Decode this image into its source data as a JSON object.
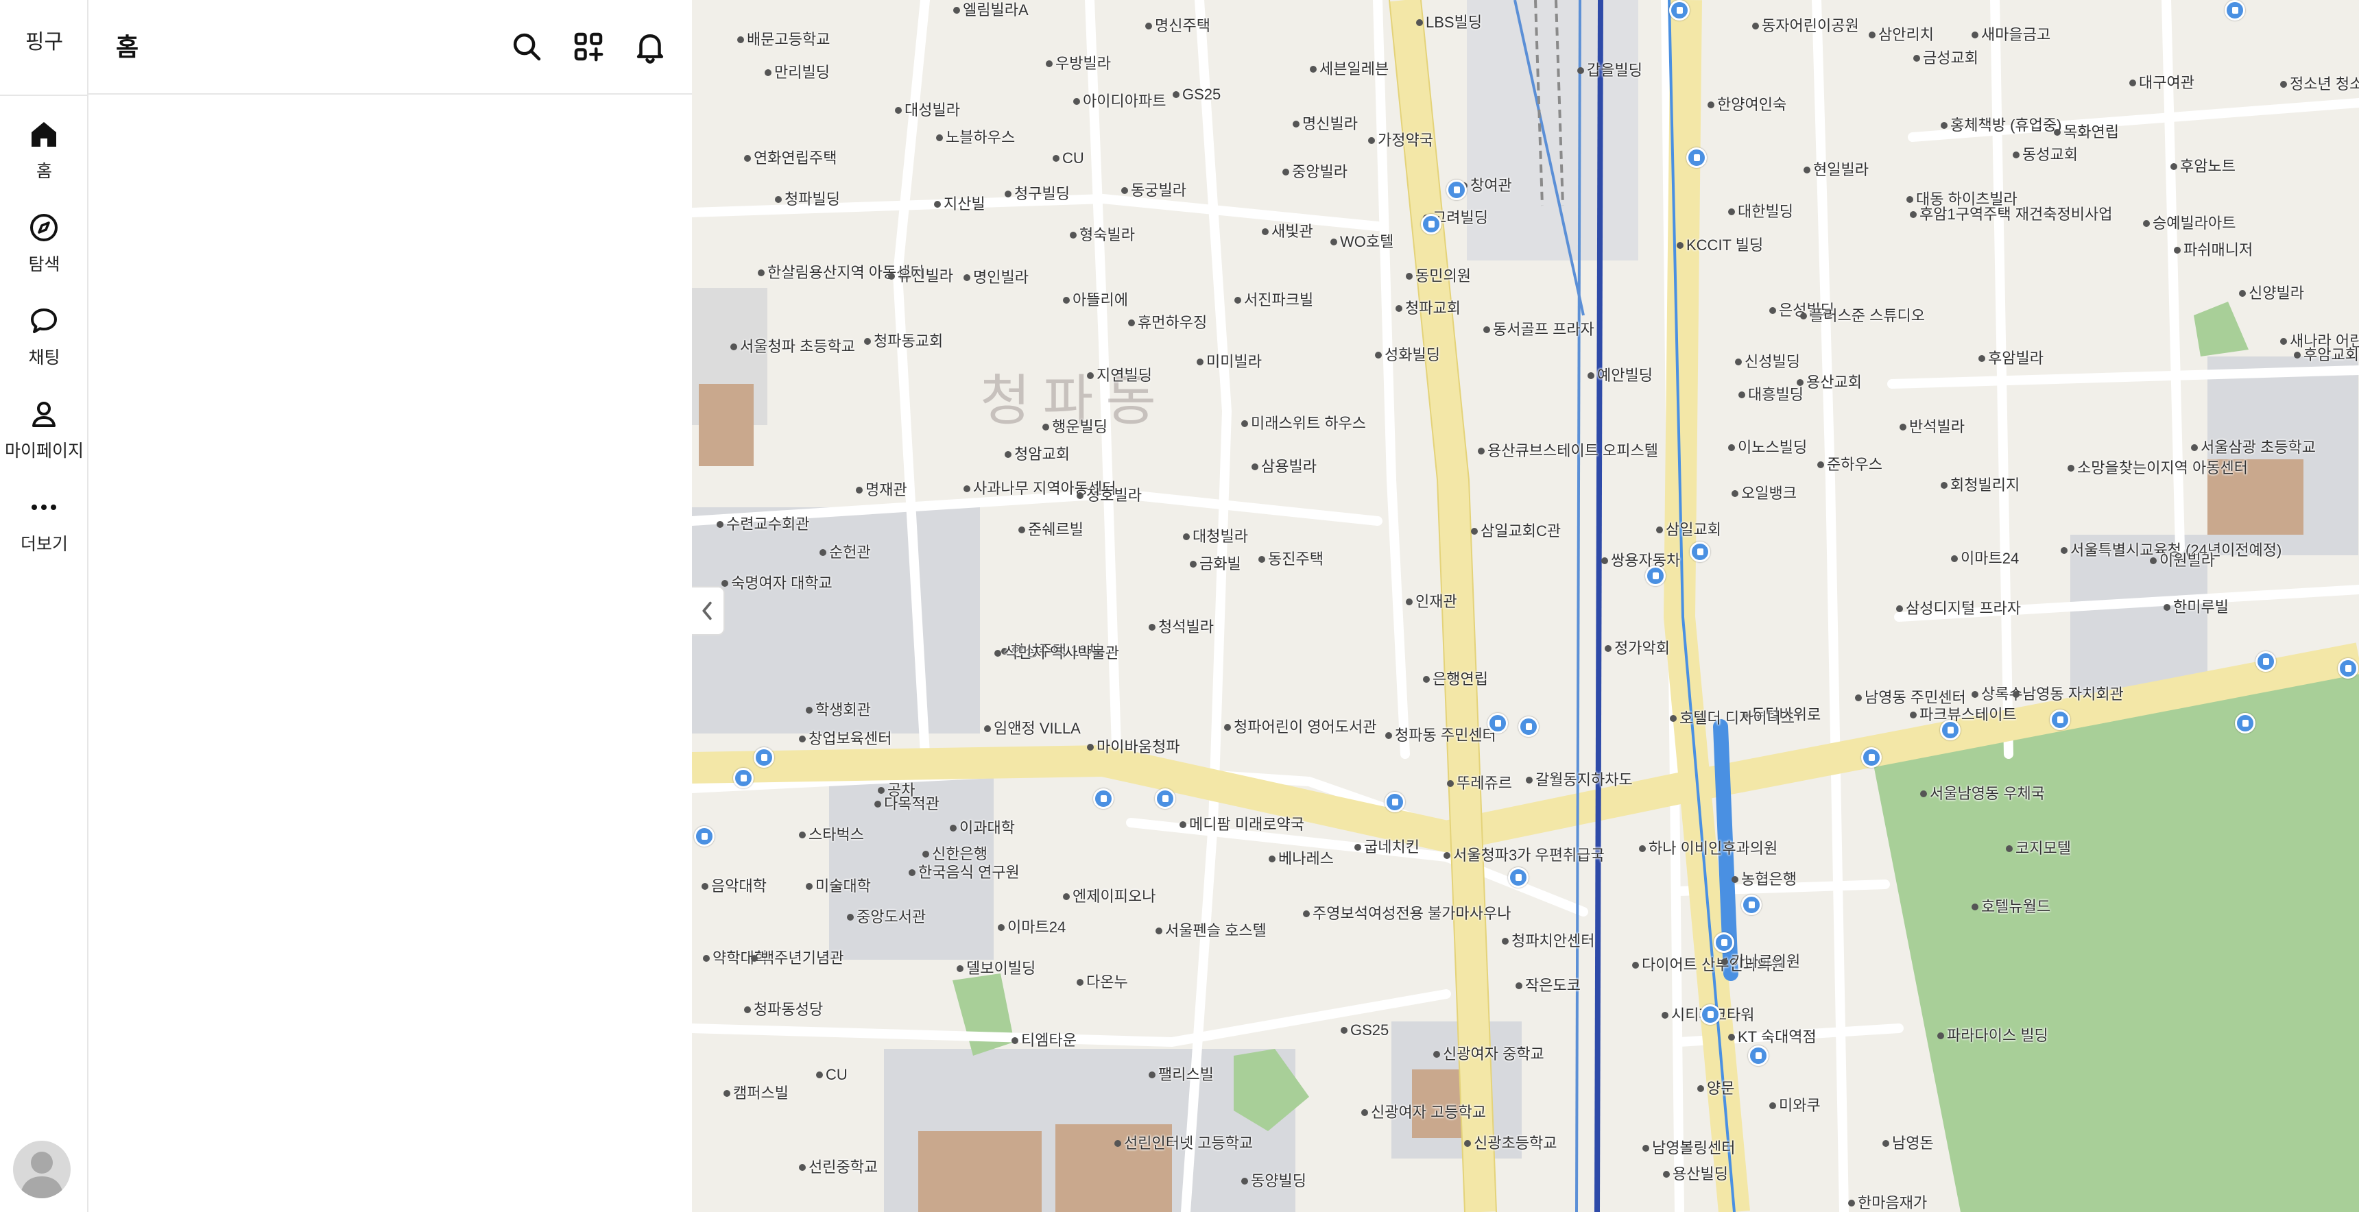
{
  "app": {
    "brand": "핑구"
  },
  "rail": {
    "items": [
      {
        "key": "home",
        "label": "홈",
        "icon": "home-icon"
      },
      {
        "key": "explore",
        "label": "탐색",
        "icon": "compass-icon"
      },
      {
        "key": "chat",
        "label": "채팅",
        "icon": "chat-bubble-icon"
      },
      {
        "key": "mypage",
        "label": "마이페이지",
        "icon": "user-icon"
      },
      {
        "key": "more",
        "label": "더보기",
        "icon": "more-dots-icon"
      }
    ],
    "avatar_icon": "avatar-icon"
  },
  "panel": {
    "title": "홈",
    "header_icons": [
      "search-icon",
      "apps-add-icon",
      "bell-icon"
    ]
  },
  "map": {
    "district_name": "청파동",
    "labels": [
      "엘림빌라A",
      "명신주택",
      "LBS빌딩",
      "동자어린이공원",
      "삼안리치",
      "새마을금고",
      "배문고등학교",
      "우방빌라",
      "세븐일레븐",
      "갑을빌딩",
      "금성교회",
      "대구여관",
      "정소년 청소년",
      "만리빌딩",
      "아이디아파트",
      "GS25",
      "명신빌라",
      "한양여인숙",
      "홍체책방 (휴업중)",
      "목화연립",
      "후암노트",
      "대성빌라",
      "노블하우스",
      "CU",
      "가정약국",
      "동성교회",
      "연화연립주택",
      "중앙빌라",
      "현일빌라",
      "청파빌딩",
      "지산빌",
      "청구빌딩",
      "동궁빌라",
      "창여관",
      "대한빌딩",
      "대동 하이츠빌라",
      "후암1구역주택 재건축정비사업",
      "승예빌라아트",
      "새빛관",
      "고려빌딩",
      "한살림용산지역 아동센터",
      "유진빌라",
      "명인빌라",
      "형숙빌라",
      "WO호텔",
      "KCCIT 빌딩",
      "동민의원",
      "파쉬매니저",
      "서울청파 초등학교",
      "아뜰리에",
      "서진파크빌",
      "청파교회",
      "신양빌라",
      "청파동교회",
      "휴먼하우징",
      "미미빌라",
      "동서골프 프라자",
      "은성빌딩",
      "플러스준 스튜디오",
      "성화빌딩",
      "새나라 어린이공원",
      "후암빌라",
      "후암교회",
      "예안빌딩",
      "신성빌딩",
      "지연빌딩",
      "대흥빌딩",
      "용산교회",
      "미래스위트 하우스",
      "행운빌딩",
      "반석빌라",
      "서울삼광 초등학교",
      "삼용빌라",
      "용산큐브스테이트 오피스텔",
      "이노스빌딩",
      "준하우스",
      "청암교회",
      "회청빌리지",
      "소망을찾는이지역 아동센터",
      "사과나무 지역아동센터",
      "명재관",
      "정호빌라",
      "오일뱅크",
      "수련교수회관",
      "준쉐르빌",
      "삼일교회C관",
      "삼일교회",
      "순헌관",
      "대청빌라",
      "쌍용자동차",
      "서울특별시교육청 (24년이전예정)",
      "숙명여자 대학교",
      "동진주택",
      "금화빌",
      "인재관",
      "이마트24",
      "이원빌라",
      "삼성디지털 프라자",
      "한미루빌",
      "한성주택 13차",
      "청석빌라",
      "정가악회",
      "식민지 역사박물관",
      "은행연립",
      "상록수",
      "남영동 자치회관",
      "남영동 주민센터",
      "두텁바위로",
      "호텔더 디자이너스",
      "파크뷰스테이트",
      "학생회관",
      "임앤정 VILLA",
      "청파어린이 영어도서관",
      "청파동 주민센터",
      "창업보육센터",
      "마이바움청파",
      "뚜레쥬르",
      "서울남영동 우체국",
      "공차",
      "코지모텔",
      "다목적관",
      "메디팜 미래로약국",
      "스타벅스",
      "갈월동지하차도",
      "하나 이비인후과의원",
      "이과대학",
      "신한은행",
      "베나레스",
      "굽네치킨",
      "서울청파3가 우편취급국",
      "농협은행",
      "호텔뉴월드",
      "음악대학",
      "미술대학",
      "한국음식 연구원",
      "엔제이피오나",
      "중앙도서관",
      "주영보석여성전용 불가마사우나",
      "이마트24",
      "서울펜슬 호스텔",
      "청파치안센터",
      "약학대학",
      "백주년기념관",
      "다이어트 산부인과의원",
      "가나르의원",
      "델보이빌딩",
      "다온누",
      "작은도코",
      "청파동성당",
      "시티파크타워",
      "티엠타운",
      "GS25",
      "KT 숙대역점",
      "파라다이스 빌딩",
      "CU",
      "팰리스빌",
      "신광여자 중학교",
      "양문",
      "미와쿠",
      "캠퍼스빌",
      "선린인터넷 고등학교",
      "신광여자 고등학교",
      "신광초등학교",
      "남영볼링센터",
      "남영돈",
      "선린중학교",
      "동양빌딩",
      "용산빌딩",
      "한마음재가"
    ]
  }
}
